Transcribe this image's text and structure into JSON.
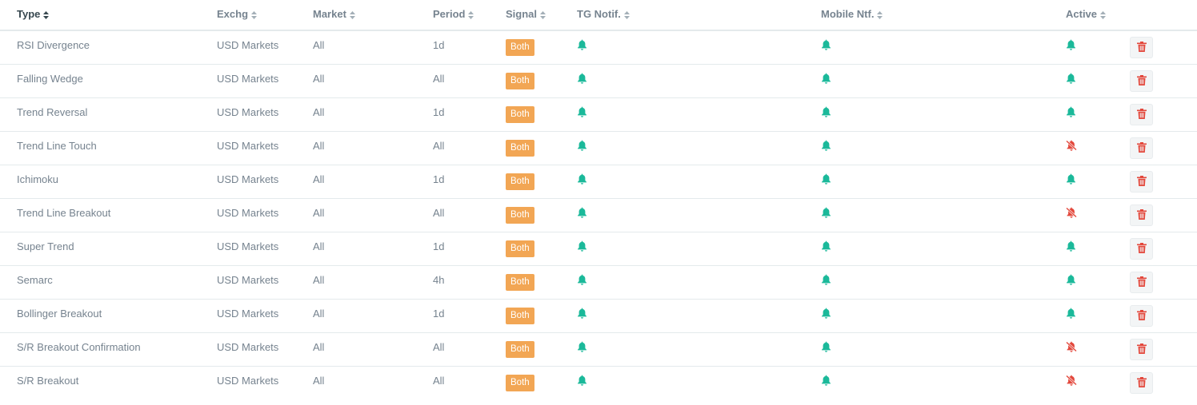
{
  "headers": {
    "type": "Type",
    "exchange": "Exchg",
    "market": "Market",
    "period": "Period",
    "signal": "Signal",
    "tg_notif": "TG Notif.",
    "mobile_notif": "Mobile Ntf.",
    "active": "Active"
  },
  "colors": {
    "bell_on": "#1bb99a",
    "bell_off": "#e3483c",
    "badge": "#f2a654",
    "trash": "#e3483c"
  },
  "icons": {
    "on": "bell-icon",
    "off": "bell-slash-icon",
    "delete": "trash-icon"
  },
  "rows": [
    {
      "type": "RSI Divergence",
      "exchange": "USD Markets",
      "market": "All",
      "period": "1d",
      "signal": "Both",
      "tg": true,
      "mobile": true,
      "active": true
    },
    {
      "type": "Falling Wedge",
      "exchange": "USD Markets",
      "market": "All",
      "period": "All",
      "signal": "Both",
      "tg": true,
      "mobile": true,
      "active": true
    },
    {
      "type": "Trend Reversal",
      "exchange": "USD Markets",
      "market": "All",
      "period": "1d",
      "signal": "Both",
      "tg": true,
      "mobile": true,
      "active": true
    },
    {
      "type": "Trend Line Touch",
      "exchange": "USD Markets",
      "market": "All",
      "period": "All",
      "signal": "Both",
      "tg": true,
      "mobile": true,
      "active": false
    },
    {
      "type": "Ichimoku",
      "exchange": "USD Markets",
      "market": "All",
      "period": "1d",
      "signal": "Both",
      "tg": true,
      "mobile": true,
      "active": true
    },
    {
      "type": "Trend Line Breakout",
      "exchange": "USD Markets",
      "market": "All",
      "period": "All",
      "signal": "Both",
      "tg": true,
      "mobile": true,
      "active": false
    },
    {
      "type": "Super Trend",
      "exchange": "USD Markets",
      "market": "All",
      "period": "1d",
      "signal": "Both",
      "tg": true,
      "mobile": true,
      "active": true
    },
    {
      "type": "Semarc",
      "exchange": "USD Markets",
      "market": "All",
      "period": "4h",
      "signal": "Both",
      "tg": true,
      "mobile": true,
      "active": true
    },
    {
      "type": "Bollinger Breakout",
      "exchange": "USD Markets",
      "market": "All",
      "period": "1d",
      "signal": "Both",
      "tg": true,
      "mobile": true,
      "active": true
    },
    {
      "type": "S/R Breakout Confirmation",
      "exchange": "USD Markets",
      "market": "All",
      "period": "All",
      "signal": "Both",
      "tg": true,
      "mobile": true,
      "active": false
    },
    {
      "type": "S/R Breakout",
      "exchange": "USD Markets",
      "market": "All",
      "period": "All",
      "signal": "Both",
      "tg": true,
      "mobile": true,
      "active": false
    }
  ]
}
